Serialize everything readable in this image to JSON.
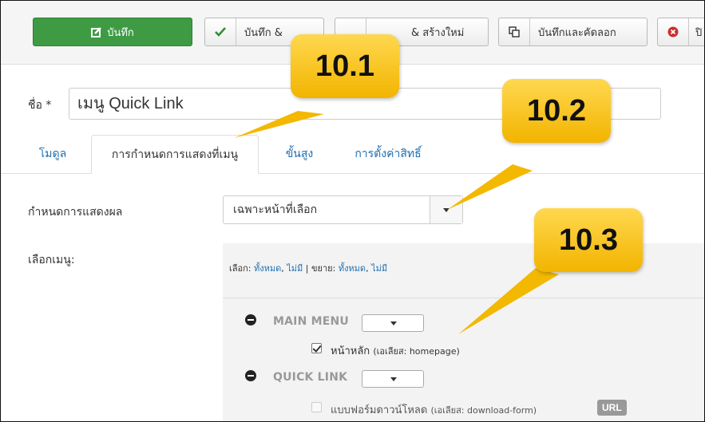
{
  "toolbar": {
    "save": {
      "label": "บันทึก",
      "icon": "edit-icon"
    },
    "save_close": {
      "label": "บันทึก &",
      "icon": "check-icon"
    },
    "save_new": {
      "label": "& สร้างใหม่"
    },
    "save_copy": {
      "label": "บันทึกและคัดลอก",
      "icon": "copy-icon"
    },
    "close": {
      "label": "ปิ",
      "icon": "close-circle-icon"
    }
  },
  "form": {
    "title_label": "ชื่อ *",
    "title_value": "เมนู Quick Link"
  },
  "tabs": [
    {
      "label": "โมดูล",
      "active": false
    },
    {
      "label": "การกำหนดการแสดงที่เมนู",
      "active": true
    },
    {
      "label": "ขั้นสูง",
      "active": false
    },
    {
      "label": "การตั้งค่าสิทธิ์",
      "active": false
    }
  ],
  "assignment": {
    "label": "กำหนดการแสดงผล",
    "selected": "เฉพาะหน้าที่เลือก"
  },
  "menu_select": {
    "label": "เลือกเมนู:",
    "select_prefix": "เลือก: ",
    "all": "ทั้งหมด",
    "none": "ไม่มี",
    "separator": " | ",
    "expand_prefix": "ขยาย: ",
    "comma": ", ",
    "groups": [
      {
        "title": "MAIN MENU",
        "items": [
          {
            "label": "หน้าหลัก",
            "alias": "(เอเลียส: homepage)",
            "checked": true
          }
        ]
      },
      {
        "title": "QUICK LINK",
        "items": [
          {
            "label": "แบบฟอร์มดาวน์โหลด",
            "alias": "(เอเลียส: download-form)",
            "checked": false,
            "badge": "URL"
          }
        ]
      }
    ]
  },
  "callouts": [
    "10.1",
    "10.2",
    "10.3"
  ],
  "colors": {
    "save_green": "#3e9b44",
    "link_blue": "#1f6fb0",
    "callout_yellow": "#f9c623"
  }
}
